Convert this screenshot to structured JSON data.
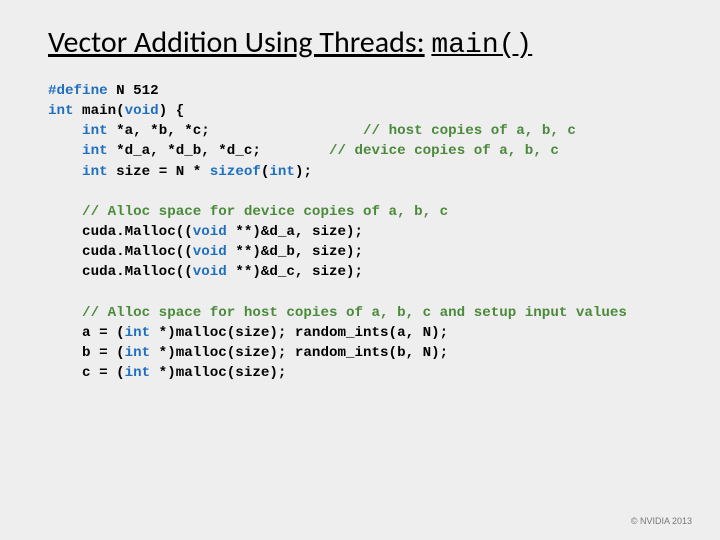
{
  "title_prefix": "Vector Addition Using Threads:",
  "title_mono": "main()",
  "code": {
    "l1a": "#define",
    "l1b": " N 512",
    "l2a": "int",
    "l2b": " main(",
    "l2c": "void",
    "l2d": ") {",
    "l3a": "    int",
    "l3b": " *a, *b, *c;                  ",
    "l3c": "// host copies of a, b, c",
    "l4a": "    int",
    "l4b": " *d_a, *d_b, *d_c;        ",
    "l4c": "// device copies of a, b, c",
    "l5a": "    int",
    "l5b": " size = N * ",
    "l5c": "sizeof",
    "l5d": "(",
    "l5e": "int",
    "l5f": ");",
    "l7a": "    // Alloc space for device copies of a, b, c",
    "l8a": "    cuda.Malloc((",
    "l8b": "void",
    "l8c": " **)&d_a, size);",
    "l9a": "    cuda.Malloc((",
    "l9b": "void",
    "l9c": " **)&d_b, size);",
    "l10a": "    cuda.Malloc((",
    "l10b": "void",
    "l10c": " **)&d_c, size);",
    "l12a": "    // Alloc space for host copies of a, b, c and setup input values",
    "l13a": "    a = (",
    "l13b": "int",
    "l13c": " *)malloc(size); random_ints(a, N);",
    "l14a": "    b = (",
    "l14b": "int",
    "l14c": " *)malloc(size); random_ints(b, N);",
    "l15a": "    c = (",
    "l15b": "int",
    "l15c": " *)malloc(size);"
  },
  "footer": "© NVIDIA 2013"
}
